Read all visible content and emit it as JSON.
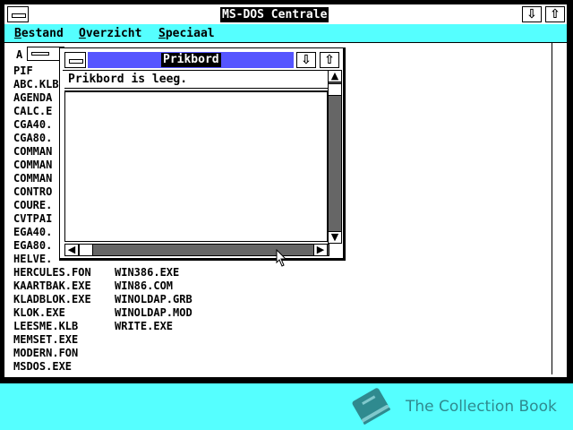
{
  "window": {
    "title": "MS-DOS Centrale",
    "min_icon": "down-arrow-icon",
    "max_icon": "up-arrow-icon"
  },
  "menu": {
    "items": [
      {
        "first": "B",
        "rest": "estand"
      },
      {
        "first": "O",
        "rest": "verzicht"
      },
      {
        "first": "S",
        "rest": "peciaal"
      }
    ]
  },
  "drive": {
    "label": "A"
  },
  "files": {
    "column1": [
      "PIF",
      "ABC.KLB",
      "AGENDA",
      "CALC.E",
      "CGA40.",
      "CGA80.",
      "COMMAN",
      "COMMAN",
      "COMMAN",
      "CONTRO",
      "COURE.",
      "CVTPAI",
      "EGA40.",
      "EGA80.",
      "HELVE.",
      "HERCULES.FON",
      "KAARTBAK.EXE",
      "KLADBLOK.EXE",
      "KLOK.EXE",
      "LEESME.KLB",
      "MEMSET.EXE",
      "MODERN.FON",
      "MSDOS.EXE"
    ],
    "column2": [
      "WIN386.EXE",
      "WIN86.COM",
      "WINOLDAP.GRB",
      "WINOLDAP.MOD",
      "WRITE.EXE"
    ]
  },
  "clipboard": {
    "title": "Prikbord",
    "message": "Prikbord is leeg."
  },
  "branding": {
    "text": "The Collection Book",
    "color": "#2F8A8F"
  },
  "colors": {
    "desktop": "#55FFFF",
    "menu_bar": "#55FFFF",
    "active_title": "#5555FF"
  }
}
